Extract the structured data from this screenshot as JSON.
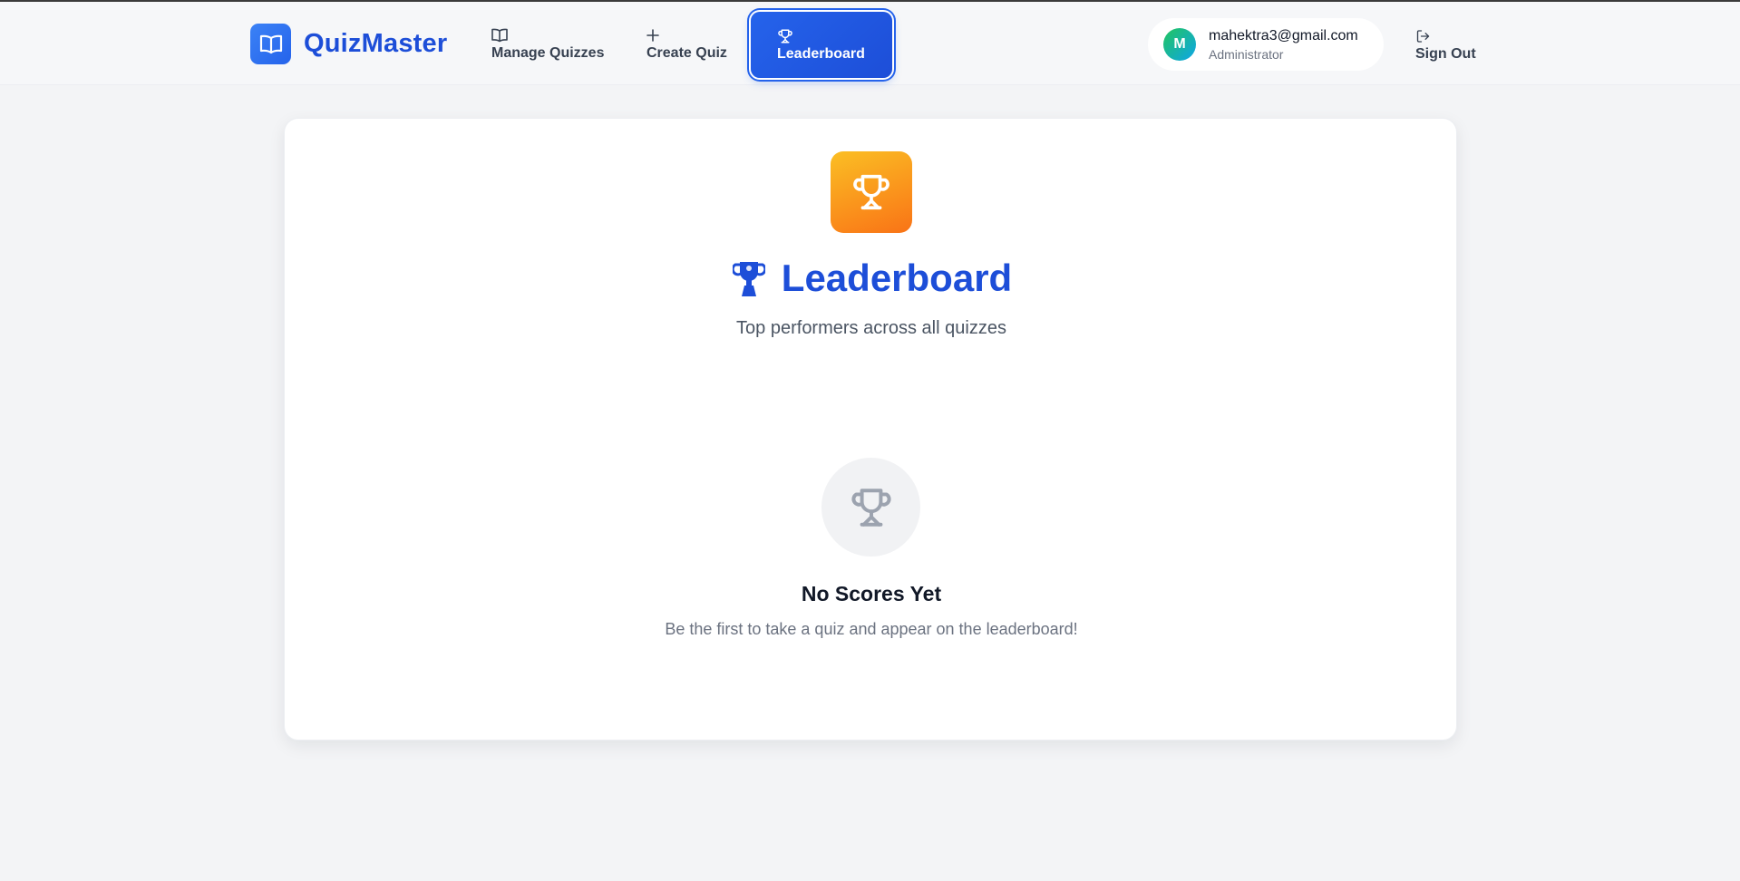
{
  "app": {
    "name": "QuizMaster",
    "logo_icon": "book-open-icon",
    "brand_color": "#1d4ed8"
  },
  "nav": {
    "items": [
      {
        "label": "Manage Quizzes",
        "icon": "book-icon",
        "active": false
      },
      {
        "label": "Create Quiz",
        "icon": "plus-icon",
        "active": false
      },
      {
        "label": "Leaderboard",
        "icon": "trophy-icon",
        "active": true
      }
    ],
    "active_bg": "#2563eb"
  },
  "user": {
    "avatar_initial": "M",
    "email": "mahektra3@gmail.com",
    "role": "Administrator"
  },
  "signout": {
    "label": "Sign Out",
    "icon": "log-out-icon"
  },
  "leaderboard": {
    "hero_icon": "trophy-icon",
    "title_emoji": "trophy-emoji-icon",
    "title": "Leaderboard",
    "subtitle": "Top performers across all quizzes",
    "accent_gradient": [
      "#fbbf24",
      "#f97316"
    ]
  },
  "empty_state": {
    "icon": "trophy-icon",
    "title": "No Scores Yet",
    "description": "Be the first to take a quiz and appear on the leaderboard!"
  }
}
